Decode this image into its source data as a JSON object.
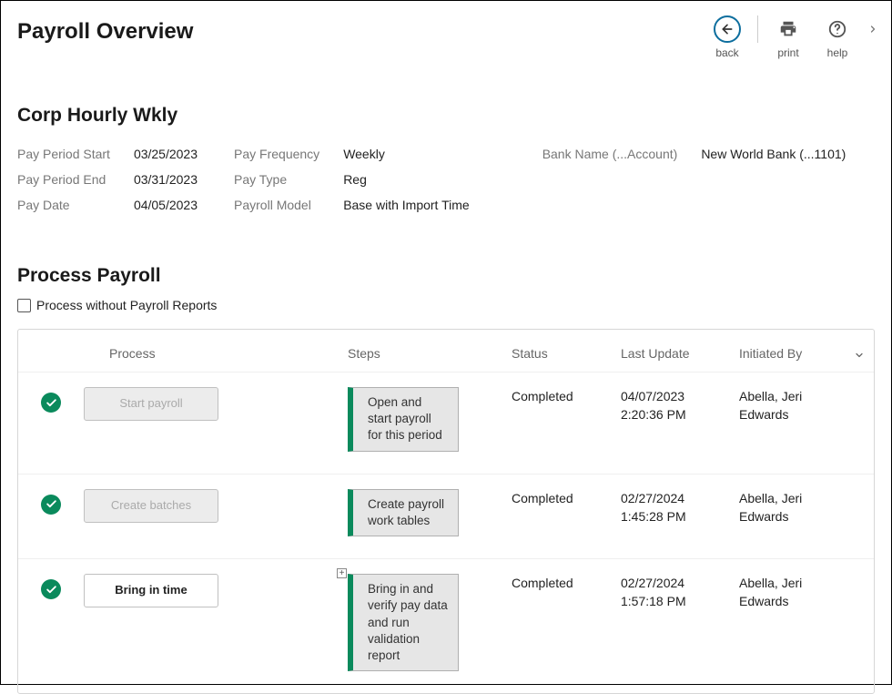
{
  "header": {
    "title": "Payroll Overview",
    "back_label": "back",
    "print_label": "print",
    "help_label": "help"
  },
  "payroll": {
    "name": "Corp Hourly Wkly",
    "meta": {
      "pay_period_start_label": "Pay Period Start",
      "pay_period_start": "03/25/2023",
      "pay_period_end_label": "Pay Period End",
      "pay_period_end": "03/31/2023",
      "pay_date_label": "Pay Date",
      "pay_date": "04/05/2023",
      "pay_frequency_label": "Pay Frequency",
      "pay_frequency": "Weekly",
      "pay_type_label": "Pay Type",
      "pay_type": "Reg",
      "payroll_model_label": "Payroll Model",
      "payroll_model": "Base with Import Time",
      "bank_label": "Bank Name (...Account)",
      "bank": "New World Bank (...1101)"
    }
  },
  "process": {
    "title": "Process Payroll",
    "checkbox_label": "Process without Payroll Reports",
    "columns": {
      "process": "Process",
      "steps": "Steps",
      "status": "Status",
      "last_update": "Last Update",
      "initiated_by": "Initiated By"
    },
    "rows": [
      {
        "button_label": "Start payroll",
        "active": false,
        "has_plus": false,
        "step_text": "Open and start payroll for this period",
        "status": "Completed",
        "last_update": "04/07/2023 2:20:36 PM",
        "initiated_by": "Abella, Jeri Edwards"
      },
      {
        "button_label": "Create batches",
        "active": false,
        "has_plus": false,
        "step_text": "Create payroll work tables",
        "status": "Completed",
        "last_update": "02/27/2024 1:45:28 PM",
        "initiated_by": "Abella, Jeri Edwards"
      },
      {
        "button_label": "Bring in time",
        "active": true,
        "has_plus": true,
        "step_text": "Bring in and verify pay data and run validation report",
        "status": "Completed",
        "last_update": "02/27/2024 1:57:18 PM",
        "initiated_by": "Abella, Jeri Edwards"
      }
    ]
  }
}
